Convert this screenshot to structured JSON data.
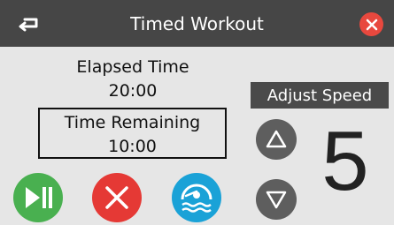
{
  "header": {
    "title": "Timed Workout",
    "back_icon": "back-arrow-icon",
    "close_icon": "close-icon"
  },
  "timer": {
    "elapsed_label": "Elapsed Time",
    "elapsed_value": "20:00",
    "remaining_label": "Time Remaining",
    "remaining_value": "10:00"
  },
  "controls": {
    "play_pause_icon": "play-pause-icon",
    "stop_icon": "stop-icon",
    "swim_icon": "swim-icon"
  },
  "speed": {
    "label": "Adjust Speed",
    "value": "5",
    "up_icon": "triangle-up-icon",
    "down_icon": "triangle-down-icon"
  },
  "colors": {
    "header_bg": "#464646",
    "close_red": "#e8483e",
    "play_green": "#49b050",
    "stop_red": "#e53935",
    "swim_blue": "#1aa2d7"
  }
}
